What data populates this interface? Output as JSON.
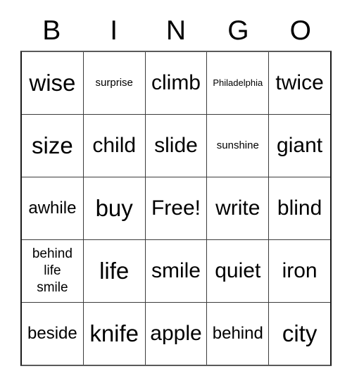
{
  "card": {
    "header": {
      "letters": [
        "B",
        "I",
        "N",
        "G",
        "O"
      ]
    },
    "rows": [
      [
        {
          "text": "wise",
          "size": "fs-xl"
        },
        {
          "text": "surprise",
          "size": "fs-xs"
        },
        {
          "text": "climb",
          "size": "fs-lg"
        },
        {
          "text": "Philadelphia",
          "size": "fs-xxs"
        },
        {
          "text": "twice",
          "size": "fs-lg"
        }
      ],
      [
        {
          "text": "size",
          "size": "fs-xl"
        },
        {
          "text": "child",
          "size": "fs-lg"
        },
        {
          "text": "slide",
          "size": "fs-lg"
        },
        {
          "text": "sunshine",
          "size": "fs-xs"
        },
        {
          "text": "giant",
          "size": "fs-lg"
        }
      ],
      [
        {
          "text": "awhile",
          "size": "fs-md"
        },
        {
          "text": "buy",
          "size": "fs-xl"
        },
        {
          "text": "Free!",
          "size": "fs-lg"
        },
        {
          "text": "write",
          "size": "fs-lg"
        },
        {
          "text": "blind",
          "size": "fs-lg"
        }
      ],
      [
        {
          "text": "behind\nlife\nsmile",
          "size": "fs-multi"
        },
        {
          "text": "life",
          "size": "fs-xl"
        },
        {
          "text": "smile",
          "size": "fs-lg"
        },
        {
          "text": "quiet",
          "size": "fs-lg"
        },
        {
          "text": "iron",
          "size": "fs-lg"
        }
      ],
      [
        {
          "text": "beside",
          "size": "fs-md"
        },
        {
          "text": "knife",
          "size": "fs-xl"
        },
        {
          "text": "apple",
          "size": "fs-lg"
        },
        {
          "text": "behind",
          "size": "fs-md"
        },
        {
          "text": "city",
          "size": "fs-xl"
        }
      ]
    ]
  },
  "colors": {
    "background": "#ffffff",
    "text": "#000000",
    "grid_line": "#3c3c3c",
    "outer_border": "#1a1a1a"
  }
}
